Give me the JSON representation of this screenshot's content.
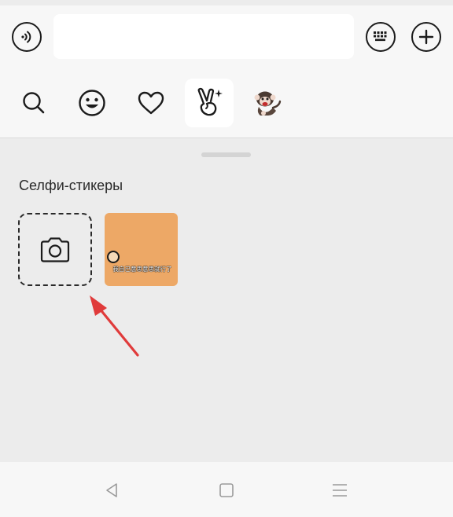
{
  "toolbar": {
    "voice_icon": "voice-input-icon",
    "message_input_value": "",
    "keyboard_icon": "keyboard-icon",
    "more_icon": "plus-icon"
  },
  "tabs": [
    {
      "icon": "search-icon",
      "active": false
    },
    {
      "icon": "smiley-icon",
      "active": false
    },
    {
      "icon": "heart-icon",
      "active": false
    },
    {
      "icon": "selfie-sticker-icon",
      "active": true
    },
    {
      "icon": "monkey-sticker-pack-icon",
      "active": false
    }
  ],
  "stickers_panel": {
    "section_title": "Селфи-стикеры",
    "add_button_icon": "camera-icon",
    "items": [
      {
        "caption": "我自己意思意思就行了"
      }
    ]
  },
  "annotation": {
    "color": "#e03b3b"
  },
  "navbar": {
    "back_icon": "back-triangle-icon",
    "home_icon": "home-square-icon",
    "menu_icon": "menu-lines-icon"
  },
  "colors": {
    "sticker_bg": "#eda866",
    "panel_bg": "#ececec",
    "toolbar_bg": "#f7f7f7"
  }
}
